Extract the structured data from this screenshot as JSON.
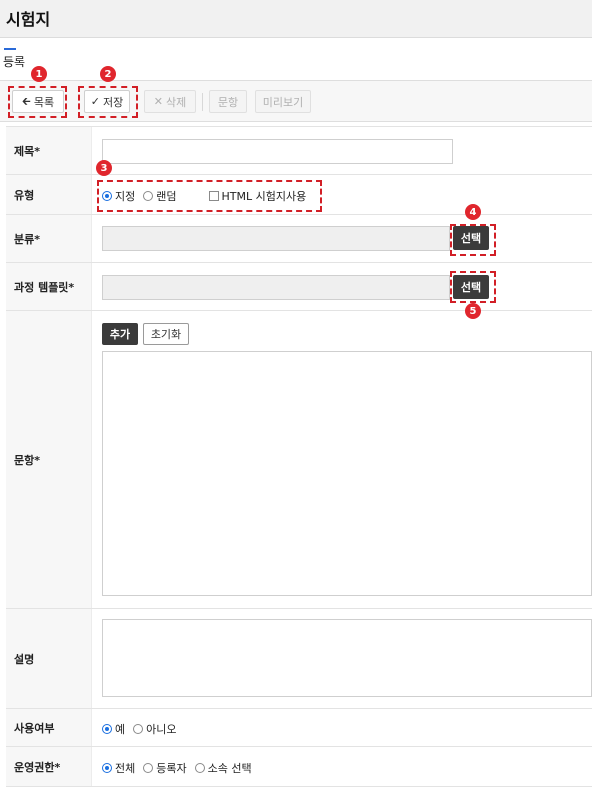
{
  "header": {
    "title": "시험지"
  },
  "section": {
    "label": "등록"
  },
  "toolbar": {
    "list_label": "목록",
    "save_label": "저장",
    "delete_label": "삭제",
    "question_label": "문항",
    "preview_label": "미리보기"
  },
  "form": {
    "title_label": "제목*",
    "title_value": "",
    "type_label": "유형",
    "type_options": [
      "지정",
      "랜덤"
    ],
    "type_selected": "지정",
    "html_checkbox_label": "HTML 시험지사용",
    "html_checked": false,
    "category_label": "분류*",
    "category_value": "",
    "course_template_label": "과정 템플릿*",
    "course_template_value": "",
    "select_label": "선택",
    "question_items_label": "문항*",
    "add_label": "추가",
    "reset_label": "초기화",
    "description_label": "설명",
    "usage_label": "사용여부",
    "usage_options": [
      "예",
      "아니오"
    ],
    "usage_selected": "예",
    "permission_label": "운영권한*",
    "permission_options": [
      "전체",
      "등록자",
      "소속 선택"
    ],
    "permission_selected": "전체"
  },
  "markers": [
    "1",
    "2",
    "3",
    "4",
    "5"
  ],
  "colors": {
    "accent": "#1a6fe0",
    "marker": "#e0262d",
    "dark_button": "#3b3b3b"
  }
}
